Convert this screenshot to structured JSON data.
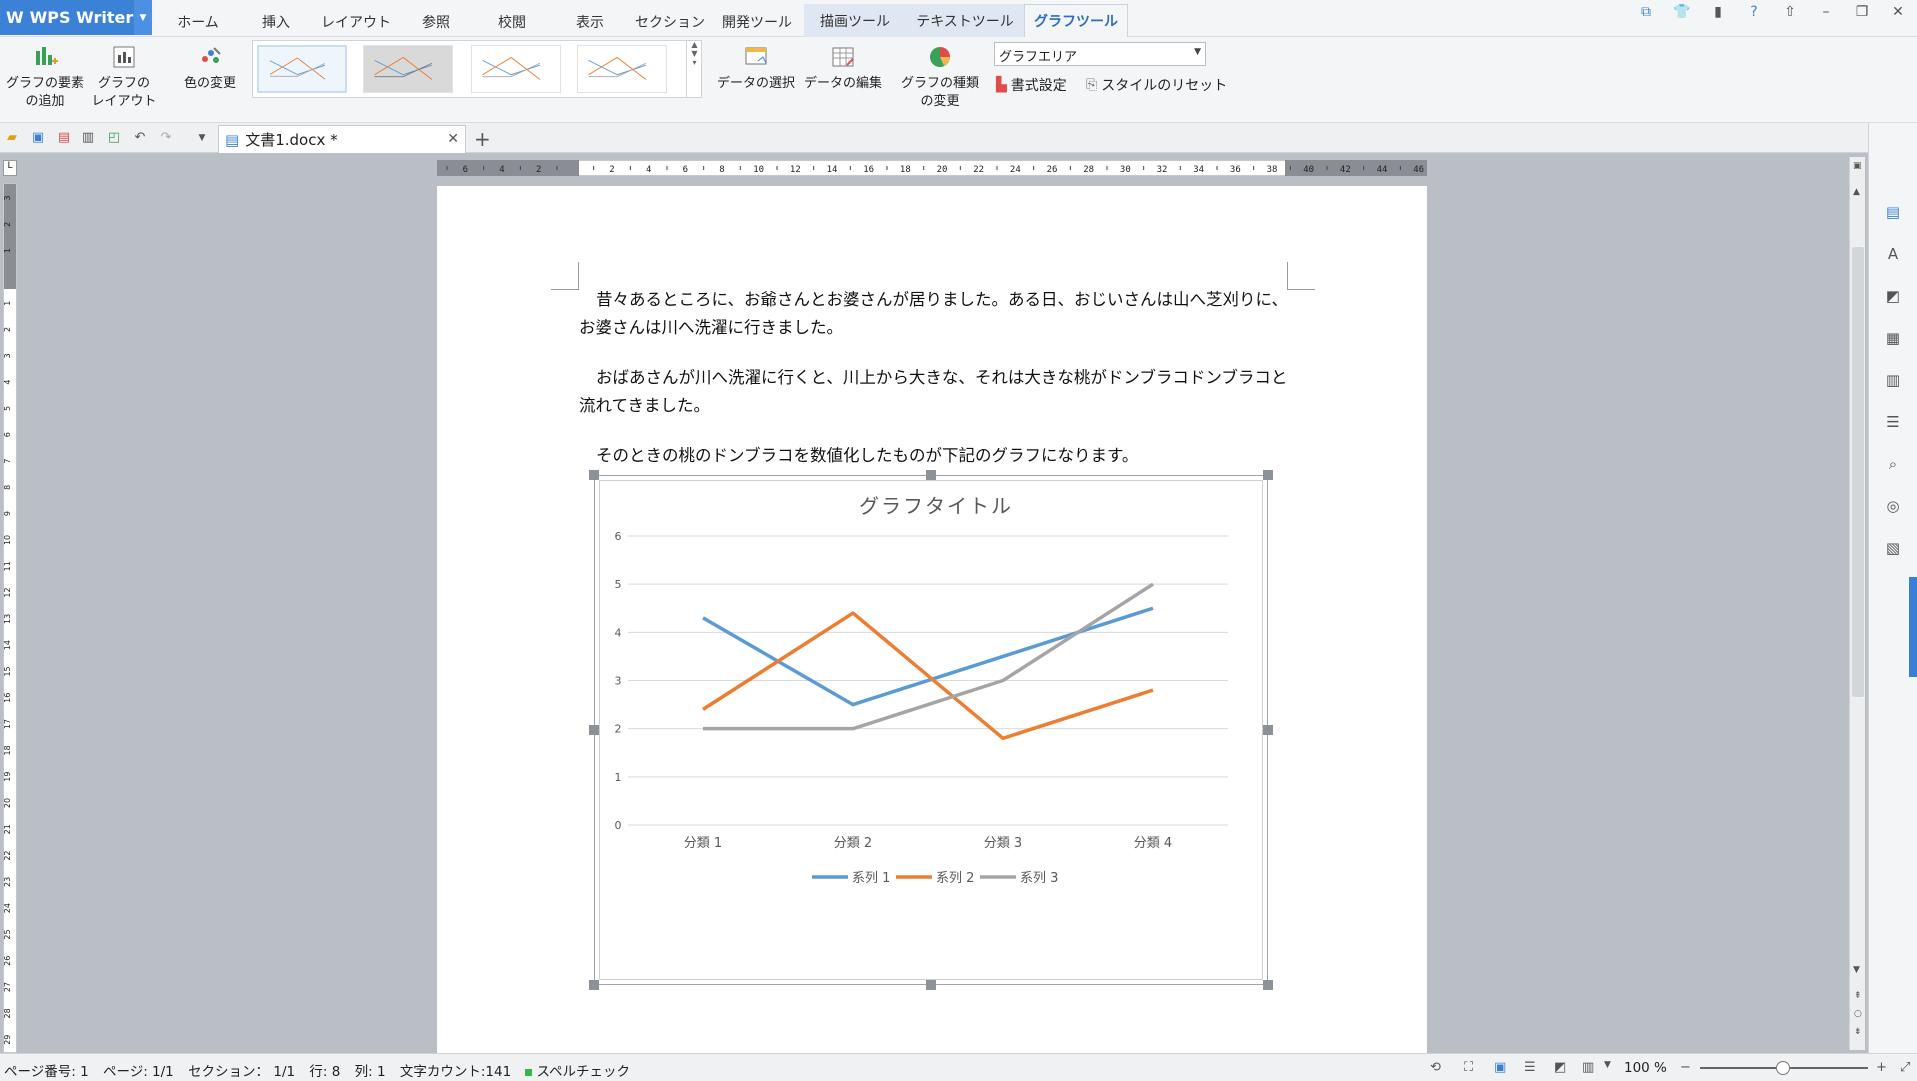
{
  "app": {
    "name": "WPS Writer"
  },
  "menu_tabs": [
    "ホーム",
    "挿入",
    "レイアウト",
    "参照",
    "校閲",
    "表示",
    "セクション",
    "開発ツール"
  ],
  "context_tabs": [
    "描画ツール",
    "テキストツール",
    "グラフツール"
  ],
  "active_tab": "グラフツール",
  "ribbon": {
    "add_element": [
      "グラフの要素",
      "の追加"
    ],
    "chart_layout": [
      "グラフの",
      "レイアウト"
    ],
    "change_color": "色の変更",
    "select_data": "データの選択",
    "edit_data": "データの編集",
    "change_type": [
      "グラフの種類",
      "の変更"
    ],
    "area_select_value": "グラフエリア",
    "format": "書式設定",
    "reset_style": "スタイルのリセット"
  },
  "document_tab": {
    "title": "文書1.docx *"
  },
  "document": {
    "paragraphs": [
      "昔々あるところに、お爺さんとお婆さんが居りました。ある日、おじいさんは山へ芝刈りに、お婆さんは川へ洗濯に行きました。",
      "おばあさんが川へ洗濯に行くと、川上から大きな、それは大きな桃がドンブラコドンブラコと流れてきました。",
      "そのときの桃のドンブラコを数値化したものが下記のグラフになります。"
    ]
  },
  "chart_data": {
    "type": "line",
    "title": "グラフタイトル",
    "categories": [
      "分類 1",
      "分類 2",
      "分類 3",
      "分類 4"
    ],
    "ylim": [
      0,
      6
    ],
    "yticks": [
      0,
      1,
      2,
      3,
      4,
      5,
      6
    ],
    "grid": true,
    "legend": "bottom",
    "series": [
      {
        "name": "系列 1",
        "values": [
          4.3,
          2.5,
          3.5,
          4.5
        ],
        "color": "#5b9bd5"
      },
      {
        "name": "系列 2",
        "values": [
          2.4,
          4.4,
          1.8,
          2.8
        ],
        "color": "#ed7d31"
      },
      {
        "name": "系列 3",
        "values": [
          2.0,
          2.0,
          3.0,
          5.0
        ],
        "color": "#a5a5a5"
      }
    ]
  },
  "status": {
    "page_no": "ページ番号: 1",
    "page": "ページ: 1/1",
    "section": "セクション： 1/1",
    "line": "行: 8",
    "col": "列: 1",
    "word_count": "文字カウント:141",
    "spell": "スペルチェック",
    "zoom": "100 %"
  },
  "ruler": {
    "h_labels": [
      "6",
      "4",
      "2",
      "",
      "2",
      "4",
      "6",
      "8",
      "10",
      "12",
      "14",
      "16",
      "18",
      "20",
      "22",
      "24",
      "26",
      "28",
      "30",
      "32",
      "34",
      "36",
      "38",
      "40",
      "42",
      "44",
      "46"
    ],
    "v_labels": [
      "3",
      "2",
      "1",
      "",
      "1",
      "2",
      "3",
      "4",
      "5",
      "6",
      "7",
      "8",
      "9",
      "10",
      "11",
      "12",
      "13",
      "14",
      "15",
      "16",
      "17",
      "18",
      "19",
      "20",
      "21",
      "22",
      "23",
      "24",
      "25",
      "26",
      "27",
      "28",
      "29"
    ]
  },
  "colors": {
    "accent": "#3b82d6",
    "active_tab_text": "#2b6cc4"
  }
}
